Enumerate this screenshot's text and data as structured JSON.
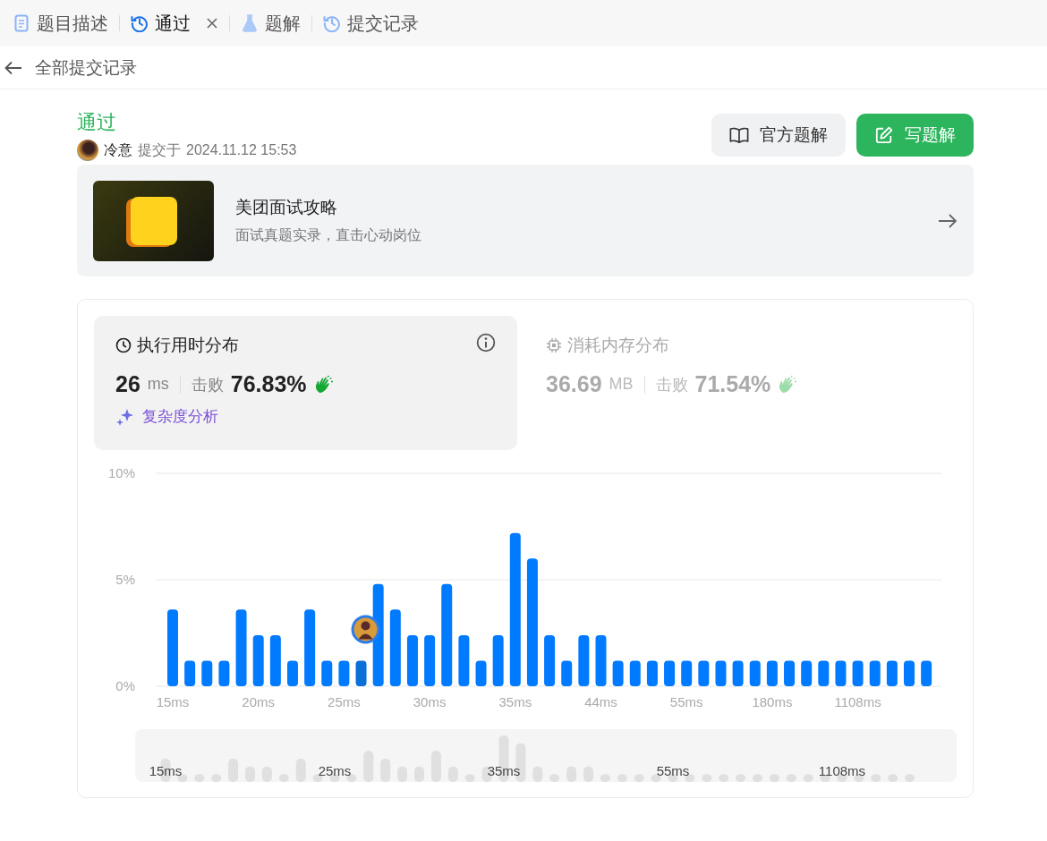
{
  "tabs": [
    {
      "kind": "description",
      "label": "题目描述",
      "selected": false
    },
    {
      "kind": "result",
      "label": "通过",
      "selected": true
    },
    {
      "kind": "solution",
      "label": "题解",
      "selected": false
    },
    {
      "kind": "history",
      "label": "提交记录",
      "selected": false
    }
  ],
  "back_link": "全部提交记录",
  "submission": {
    "status": "通过",
    "user": "冷意",
    "submitted_label": "提交于",
    "time": "2024.11.12 15:53"
  },
  "actions": [
    {
      "kind": "official",
      "label": "官方题解"
    },
    {
      "kind": "write",
      "label": "写题解"
    }
  ],
  "promo": {
    "title": "美团面试攻略",
    "subtitle": "面试真题实录，直击心动岗位"
  },
  "stats": [
    {
      "kind": "time",
      "title": "执行用时分布",
      "value": "26",
      "unit": "ms",
      "beat_label": "击败",
      "percent": "76.83%",
      "selected": true,
      "analysis_link": "复杂度分析"
    },
    {
      "kind": "memory",
      "title": "消耗内存分布",
      "value": "36.69",
      "unit": "MB",
      "beat_label": "击败",
      "percent": "71.54%",
      "selected": false
    }
  ],
  "chart_data": {
    "type": "bar",
    "categories": [
      "15ms",
      null,
      null,
      null,
      null,
      "20ms",
      null,
      null,
      null,
      null,
      "25ms",
      null,
      null,
      null,
      null,
      "30ms",
      null,
      null,
      null,
      null,
      "35ms",
      null,
      null,
      null,
      null,
      "44ms",
      null,
      null,
      null,
      null,
      "55ms",
      null,
      null,
      null,
      null,
      "180ms",
      null,
      null,
      null,
      null,
      "1108ms",
      null,
      null,
      null,
      null
    ],
    "values": [
      3.6,
      1.2,
      1.2,
      1.2,
      3.6,
      2.4,
      2.4,
      1.2,
      3.6,
      1.2,
      1.2,
      1.2,
      4.8,
      3.6,
      2.4,
      2.4,
      4.8,
      2.4,
      1.2,
      2.4,
      7.2,
      6.0,
      2.4,
      1.2,
      2.4,
      2.4,
      1.2,
      1.2,
      1.2,
      1.2,
      1.2,
      1.2,
      1.2,
      1.2,
      1.2,
      1.2,
      1.2,
      1.2,
      1.2,
      1.2,
      1.2,
      1.2,
      1.2,
      1.2,
      1.2
    ],
    "ylim": [
      0,
      10
    ],
    "yticks": [
      {
        "value": 0,
        "label": "0%"
      },
      {
        "value": 5,
        "label": "5%"
      },
      {
        "value": 10,
        "label": "10%"
      }
    ]
  },
  "chart_marker": {
    "bar_has_user": [
      false,
      false,
      false,
      false,
      false,
      false,
      false,
      false,
      false,
      false,
      false,
      true,
      false,
      false,
      false,
      false,
      false,
      false,
      false,
      false,
      false,
      false,
      false,
      false,
      false,
      false,
      false,
      false,
      false,
      false,
      false,
      false,
      false,
      false,
      false,
      false,
      false,
      false,
      false,
      false,
      false,
      false,
      false,
      false,
      false
    ]
  },
  "overview": {
    "labels": [
      "15ms",
      "25ms",
      "35ms",
      "55ms",
      "1108ms"
    ]
  }
}
